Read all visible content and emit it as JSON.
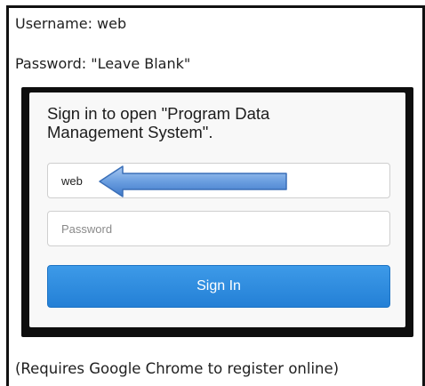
{
  "instructions": {
    "username_line": "Username: web",
    "password_line": "Password: \"Leave Blank\"",
    "requirement_line": "(Requires Google Chrome to register online)"
  },
  "signin_dialog": {
    "title": "Sign in to open \"Program Data Management System\".",
    "username_value": "web",
    "password_placeholder": "Password",
    "signin_button_label": "Sign In"
  },
  "annotation": {
    "arrow_icon": "left-arrow-icon",
    "arrow_color": "#5b8fd6"
  },
  "colors": {
    "button_blue": "#2d8be0",
    "frame_border": "#111111"
  }
}
